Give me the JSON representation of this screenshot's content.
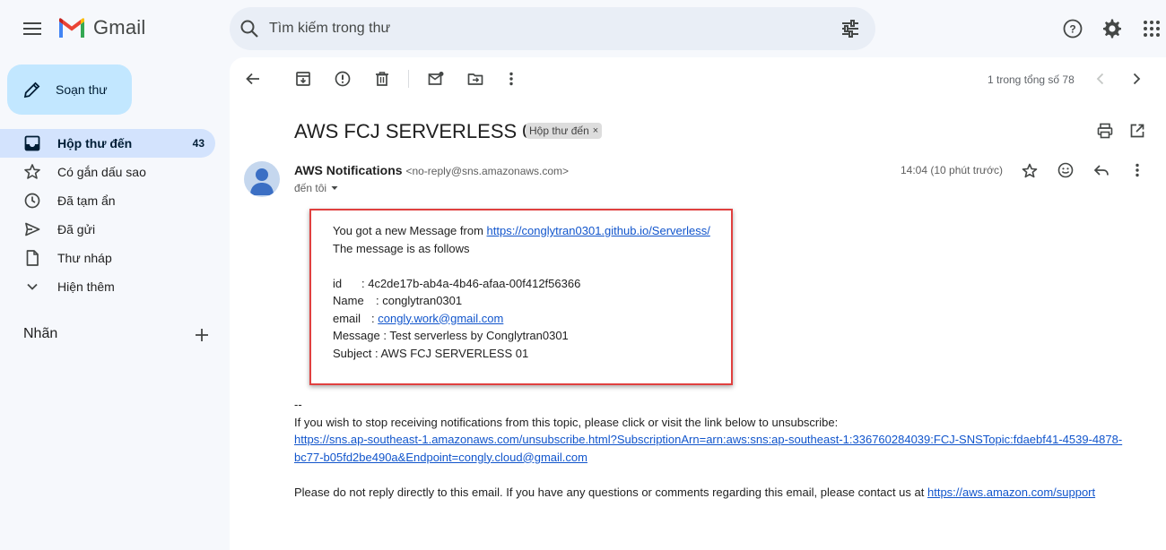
{
  "app": {
    "name": "Gmail",
    "accent_color": "#c2e7ff",
    "active_nav_color": "#d3e3fd"
  },
  "search": {
    "placeholder": "Tìm kiếm trong thư"
  },
  "sidebar": {
    "compose_label": "Soạn thư",
    "items": [
      {
        "label": "Hộp thư đến",
        "count": "43",
        "icon": "inbox-icon",
        "active": true
      },
      {
        "label": "Có gắn dấu sao",
        "count": "",
        "icon": "star-icon",
        "active": false
      },
      {
        "label": "Đã tạm ẩn",
        "count": "",
        "icon": "clock-icon",
        "active": false
      },
      {
        "label": "Đã gửi",
        "count": "",
        "icon": "send-icon",
        "active": false
      },
      {
        "label": "Thư nháp",
        "count": "",
        "icon": "draft-icon",
        "active": false
      },
      {
        "label": "Hiện thêm",
        "count": "",
        "icon": "chevron-down-icon",
        "active": false
      }
    ],
    "labels_title": "Nhãn"
  },
  "toolbar": {
    "pager_text": "1 trong tổng số 78"
  },
  "message": {
    "subject": "AWS FCJ SERVERLESS 01",
    "label_chip": "Hộp thư đến",
    "sender_name": "AWS Notifications",
    "sender_email": "<no-reply@sns.amazonaws.com>",
    "to": "đến tôi",
    "time": "14:04 (10 phút trước)",
    "body": {
      "intro": "You got a new Message from ",
      "intro_link": "https://conglytran0301.github.io/Serverless/",
      "follows": "The message is as follows",
      "id_label": "id",
      "id_value": ": 4c2de17b-ab4a-4b46-afaa-00f412f56366",
      "name_label": "Name",
      "name_value": ": conglytran0301",
      "email_label": "email",
      "email_sep": ": ",
      "email_value": "congly.work@gmail.com",
      "message_line": "Message : Test serverless by Conglytran0301",
      "subject_line": "Subject : AWS FCJ SERVERLESS 01",
      "signature_sep": "--",
      "unsubscribe_text": "If you wish to stop receiving notifications from this topic, please click or visit the link below to unsubscribe:",
      "unsubscribe_link_1": "https://sns.ap-southeast-1.amazonaws.com/unsubscribe.html?SubscriptionArn=arn:aws:sns:ap-southeast-1:336760284039:FCJ-SNSTopic:fdaebf41-4539-4878-",
      "unsubscribe_link_2": "bc77-b05fd2be490a&Endpoint=congly.cloud@gmail.com",
      "footer_text": "Please do not reply directly to this email. If you have any questions or comments regarding this email, please contact us at ",
      "footer_link": "https://aws.amazon.com/support"
    }
  }
}
